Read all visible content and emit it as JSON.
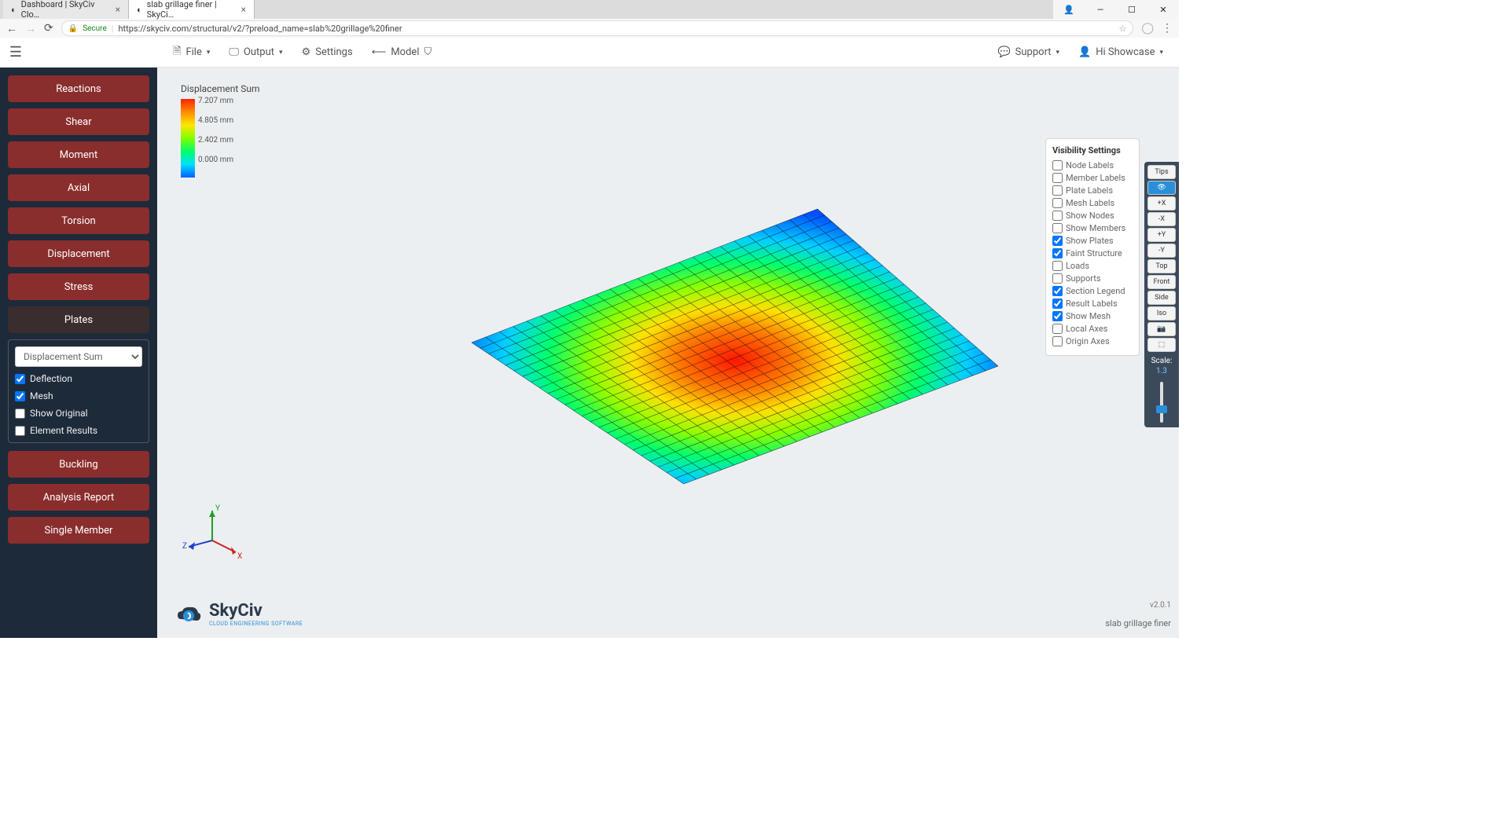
{
  "browser": {
    "tabs": [
      {
        "title": "Dashboard | SkyCiv Clo…"
      },
      {
        "title": "slab grillage finer | SkyCi…"
      }
    ],
    "secure_label": "Secure",
    "url": "https://skyciv.com/structural/v2/?preload_name=slab%20grillage%20finer"
  },
  "toolbar": {
    "file": "File",
    "output": "Output",
    "settings": "Settings",
    "model": "Model",
    "support": "Support",
    "user": "Hi Showcase"
  },
  "sidebar": {
    "buttons": [
      "Reactions",
      "Shear",
      "Moment",
      "Axial",
      "Torsion",
      "Displacement",
      "Stress",
      "Plates"
    ],
    "select": "Displacement Sum",
    "checks": [
      {
        "label": "Deflection",
        "checked": true
      },
      {
        "label": "Mesh",
        "checked": true
      },
      {
        "label": "Show Original",
        "checked": false
      },
      {
        "label": "Element Results",
        "checked": false
      }
    ],
    "bottom": [
      "Buckling",
      "Analysis Report",
      "Single Member"
    ]
  },
  "legend": {
    "title": "Displacement Sum",
    "ticks": [
      "7.207 mm",
      "4.805 mm",
      "2.402 mm",
      "0.000 mm"
    ]
  },
  "visibility": {
    "title": "Visibility Settings",
    "items": [
      {
        "label": "Node Labels",
        "checked": false
      },
      {
        "label": "Member Labels",
        "checked": false
      },
      {
        "label": "Plate Labels",
        "checked": false
      },
      {
        "label": "Mesh Labels",
        "checked": false
      },
      {
        "label": "Show Nodes",
        "checked": false
      },
      {
        "label": "Show Members",
        "checked": false
      },
      {
        "label": "Show Plates",
        "checked": true
      },
      {
        "label": "Faint Structure",
        "checked": true
      },
      {
        "label": "Loads",
        "checked": false
      },
      {
        "label": "Supports",
        "checked": false
      },
      {
        "label": "Section Legend",
        "checked": true
      },
      {
        "label": "Result Labels",
        "checked": true
      },
      {
        "label": "Show Mesh",
        "checked": true
      },
      {
        "label": "Local Axes",
        "checked": false
      },
      {
        "label": "Origin Axes",
        "checked": false
      }
    ]
  },
  "right_toolbar": {
    "buttons": [
      "Tips",
      "👁",
      "+X",
      "-X",
      "+Y",
      "-Y",
      "Top",
      "Front",
      "Side",
      "Iso",
      "📷",
      "⬚"
    ],
    "scale_label": "Scale:",
    "scale_value": "1.3"
  },
  "gizmo": {
    "x": "X",
    "y": "Y",
    "z": "Z"
  },
  "logo": {
    "name": "SkyCiv",
    "tag": "CLOUD ENGINEERING SOFTWARE"
  },
  "footer": {
    "version": "v2.0.1",
    "project": "slab grillage finer"
  },
  "chart_data": {
    "type": "heatmap",
    "title": "Displacement Sum",
    "unit": "mm",
    "value_range": [
      0.0,
      7.207
    ],
    "colormap_ticks": [
      0.0,
      2.402,
      4.805,
      7.207
    ],
    "description": "3D isometric mesh surface of a rectangular slab (~25×25 grid). Displacement magnitude contoured with rainbow colormap: 0 mm (blue) at supported edges rising smoothly to ~7.2 mm (red) at center.",
    "grid": {
      "nx": 25,
      "ny": 25,
      "center_value": 7.207,
      "edge_value": 0.0
    }
  }
}
